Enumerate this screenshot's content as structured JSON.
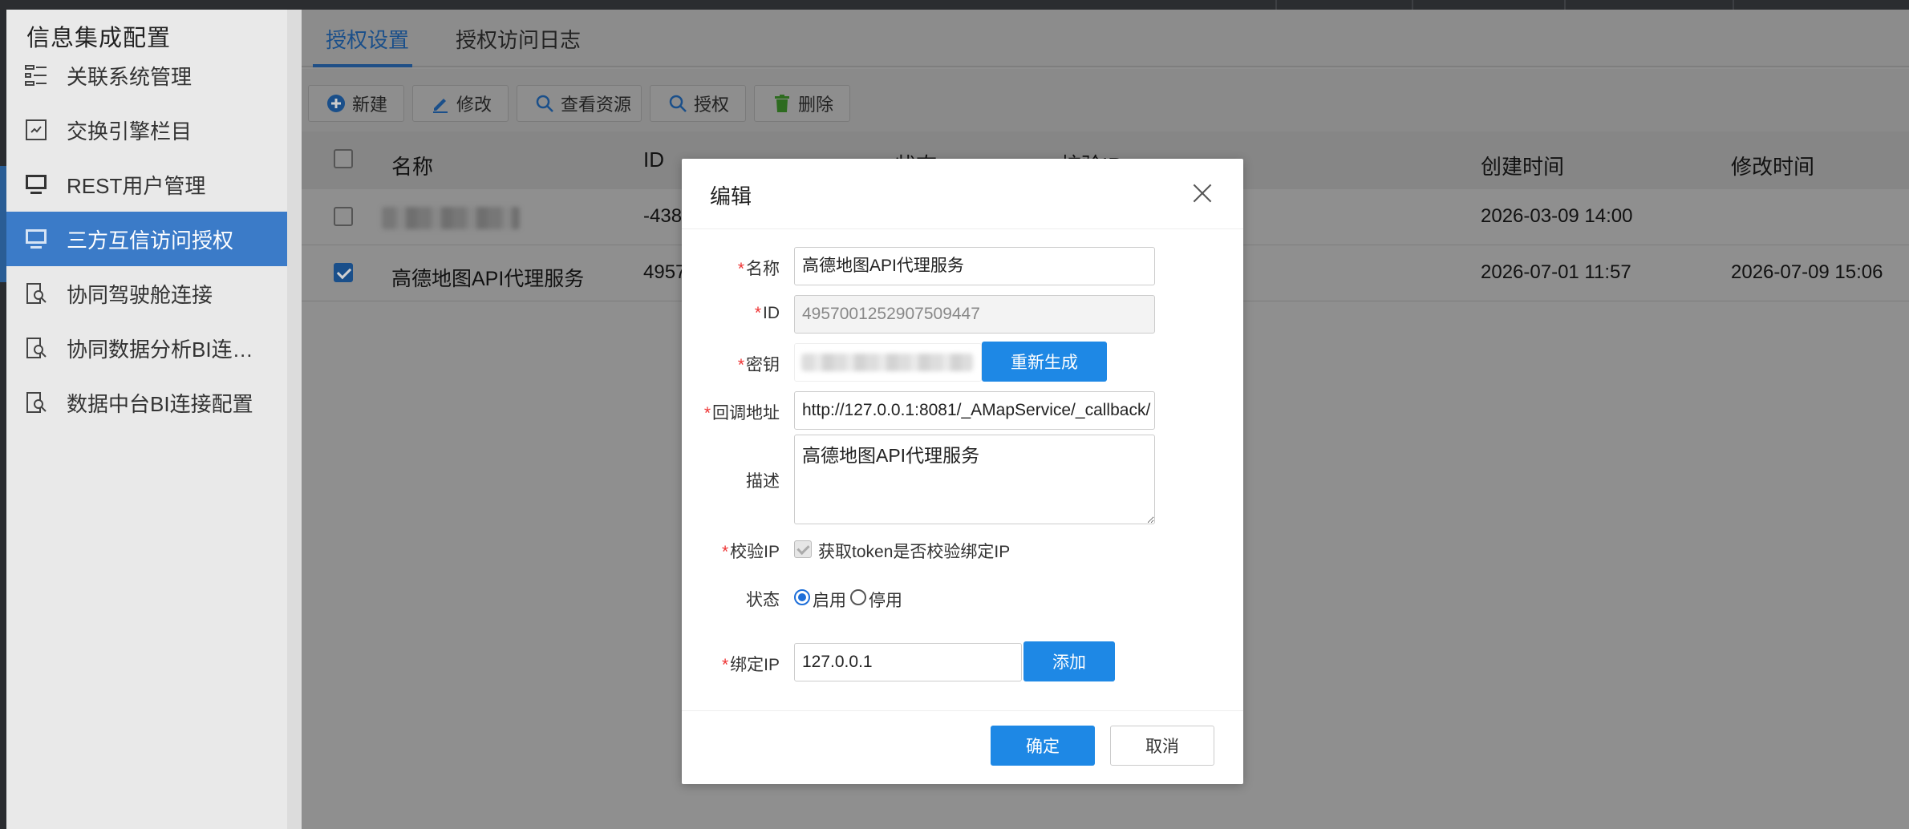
{
  "sidebar": {
    "title": "信息集成配置",
    "items": [
      {
        "label": "关联系统管理",
        "icon": "linked-system-icon"
      },
      {
        "label": "交换引擎栏目",
        "icon": "exchange-engine-icon"
      },
      {
        "label": "REST用户管理",
        "icon": "monitor-icon"
      },
      {
        "label": "三方互信访问授权",
        "icon": "monitor-icon",
        "active": true
      },
      {
        "label": "协同驾驶舱连接",
        "icon": "search-doc-icon"
      },
      {
        "label": "协同数据分析BI连…",
        "icon": "search-doc-icon"
      },
      {
        "label": "数据中台BI连接配置",
        "icon": "search-doc-icon"
      }
    ]
  },
  "tabs": [
    {
      "label": "授权设置",
      "active": true
    },
    {
      "label": "授权访问日志"
    }
  ],
  "toolbar": {
    "new": "新建",
    "edit": "修改",
    "view_resources": "查看资源",
    "authorize": "授权",
    "delete": "删除"
  },
  "table": {
    "columns": [
      "名称",
      "ID",
      "状态",
      "校验IP",
      "创建时间",
      "修改时间"
    ],
    "rows": [
      {
        "name": "",
        "id": "-438",
        "created": "2026-03-09 14:00",
        "modified": "",
        "checked": false
      },
      {
        "name": "高德地图API代理服务",
        "id": "4957",
        "created": "2026-07-01 11:57",
        "modified": "2026-07-09 15:06",
        "checked": true
      }
    ]
  },
  "modal": {
    "title": "编辑",
    "fields": {
      "name_label": "名称",
      "name_value": "高德地图API代理服务",
      "id_label": "ID",
      "id_value": "4957001252907509447",
      "secret_label": "密钥",
      "regenerate": "重新生成",
      "callback_label": "回调地址",
      "callback_value": "http://127.0.0.1:8081/_AMapService/_callback/",
      "desc_label": "描述",
      "desc_value": "高德地图API代理服务",
      "verify_ip_label": "校验IP",
      "verify_ip_text": "获取token是否校验绑定IP",
      "status_label": "状态",
      "status_on": "启用",
      "status_off": "停用",
      "bind_ip_label": "绑定IP",
      "bind_ip_value": "127.0.0.1",
      "add": "添加"
    },
    "ok": "确定",
    "cancel": "取消"
  },
  "required_mark": "*"
}
